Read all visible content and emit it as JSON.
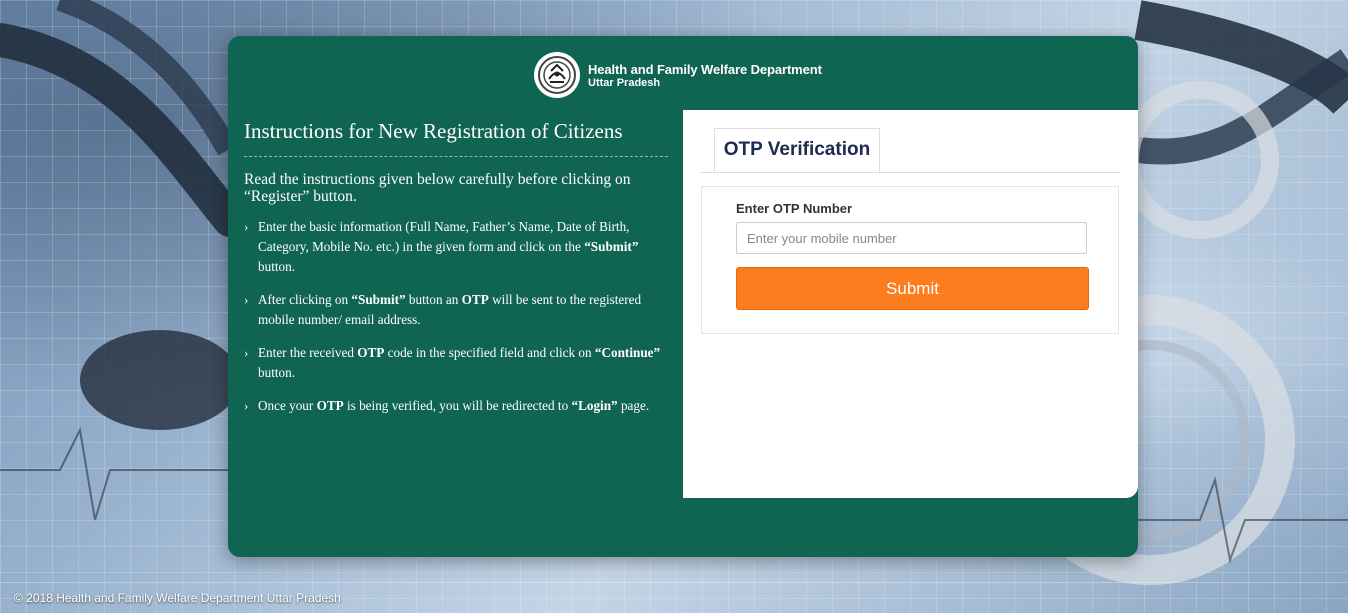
{
  "header": {
    "department": "Health and Family Welfare Department",
    "state": "Uttar Pradesh",
    "emblem_icon": "up-state-emblem-icon"
  },
  "instructions": {
    "title": "Instructions for New Registration of Citizens",
    "intro": "Read the instructions given below carefully before clicking on “Register” button.",
    "bullet_icon": "chevron-right-icon",
    "items": [
      [
        {
          "t": "Enter the basic information (Full Name, Father’s Name, Date of Birth, Category, Mobile No. etc.) in the given form and click on the "
        },
        {
          "t": "“Submit”",
          "b": true
        },
        {
          "t": " button."
        }
      ],
      [
        {
          "t": "After clicking on "
        },
        {
          "t": "“Submit”",
          "b": true
        },
        {
          "t": " button an "
        },
        {
          "t": "OTP",
          "b": true
        },
        {
          "t": " will be sent to the registered mobile number/ email address."
        }
      ],
      [
        {
          "t": "Enter the received "
        },
        {
          "t": "OTP",
          "b": true
        },
        {
          "t": " code in the specified field and click on "
        },
        {
          "t": "“Continue”",
          "b": true
        },
        {
          "t": " button."
        }
      ],
      [
        {
          "t": "Once your "
        },
        {
          "t": "OTP",
          "b": true
        },
        {
          "t": " is being verified, you will be redirected to "
        },
        {
          "t": "“Login”",
          "b": true
        },
        {
          "t": " page."
        }
      ]
    ]
  },
  "otp": {
    "tab_label": "OTP Verification",
    "field_label": "Enter OTP Number",
    "placeholder": "Enter your mobile number",
    "value": "",
    "submit_label": "Submit"
  },
  "footer": {
    "copyright": "© 2018 Health and Family Welfare Department Uttar Pradesh"
  },
  "colors": {
    "panel_green": "#0f6452",
    "submit_orange": "#fb7d1e",
    "tab_text": "#1c2b4f"
  }
}
